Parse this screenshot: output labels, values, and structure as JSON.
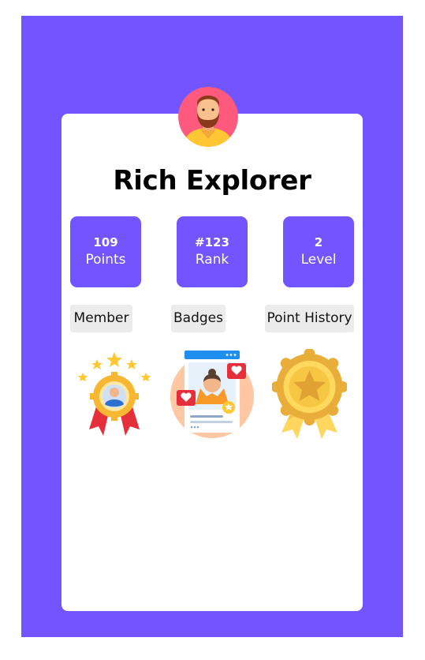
{
  "profile": {
    "name": "Rich Explorer",
    "avatar_icon": "bearded-man-avatar-icon"
  },
  "stats": [
    {
      "value": "109",
      "label": "Points"
    },
    {
      "value": "#123",
      "label": "Rank"
    },
    {
      "value": "2",
      "label": "Level"
    }
  ],
  "tabs": [
    {
      "label": "Member"
    },
    {
      "label": "Badges"
    },
    {
      "label": "Point History"
    }
  ],
  "badges": [
    {
      "icon": "member-medal-icon"
    },
    {
      "icon": "social-post-badge-icon"
    },
    {
      "icon": "gold-star-rosette-icon"
    }
  ],
  "colors": {
    "accent": "#7255ff",
    "card": "#ffffff",
    "tab_bg": "#ececec"
  }
}
